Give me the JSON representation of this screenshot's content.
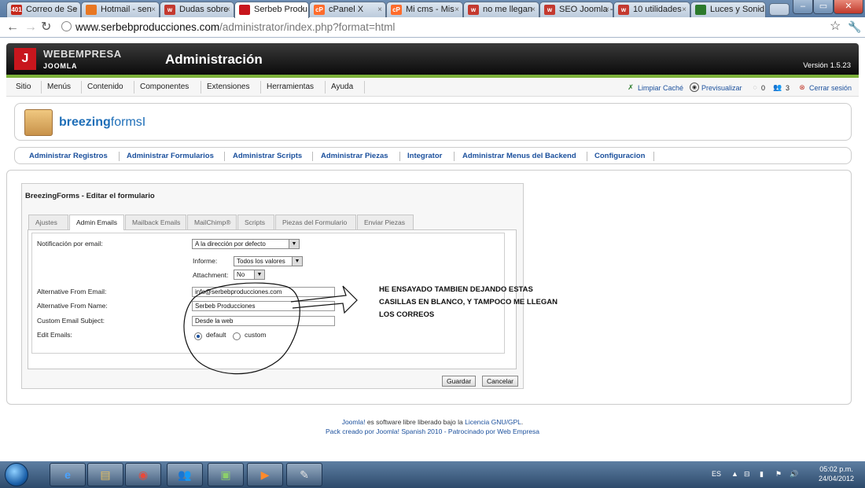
{
  "browser": {
    "tabs": [
      {
        "label": "Correo de Se",
        "favicon": "gmail-icon",
        "color": "#c5281c",
        "badge": "401"
      },
      {
        "label": "Hotmail - sen",
        "favicon": "hotmail-icon",
        "color": "#e87722"
      },
      {
        "label": "Dudas sobre",
        "favicon": "forum-icon",
        "color": "#c4392f",
        "badge": "w"
      },
      {
        "label": "Serbeb Produ",
        "favicon": "joomla-icon",
        "color": "#c8161d",
        "active": true
      },
      {
        "label": "cPanel X",
        "favicon": "cpanel-icon",
        "color": "#ff6c2c",
        "badge": "cP"
      },
      {
        "label": "Mi cms - Mis",
        "favicon": "cpanel-icon",
        "color": "#ff6c2c",
        "badge": "cP"
      },
      {
        "label": "no me llegan",
        "favicon": "forum-icon",
        "color": "#c4392f",
        "badge": "w"
      },
      {
        "label": "SEO Joomla -",
        "favicon": "forum-icon",
        "color": "#c4392f",
        "badge": "w"
      },
      {
        "label": "10 utilidades",
        "favicon": "forum-icon",
        "color": "#c4392f",
        "badge": "w"
      },
      {
        "label": "Luces y Sonid",
        "favicon": "site-icon",
        "color": "#2c7a2c"
      }
    ],
    "url_host": "www.serbebproducciones.com",
    "url_path": "/administrator/index.php?format=html"
  },
  "joomla": {
    "brand_top": "WEBEMPRESA",
    "brand_bottom": "JOOMLA",
    "title": "Administración",
    "version": "Versión 1.5.23",
    "menu": [
      "Sitio",
      "Menús",
      "Contenido",
      "Componentes",
      "Extensiones",
      "Herramientas",
      "Ayuda"
    ],
    "right": {
      "clear_cache": "Limpiar Caché",
      "preview": "Previsualizar",
      "count1": "0",
      "count2": "3",
      "logout": "Cerrar sesión"
    }
  },
  "component": {
    "logo_bold": "breezing",
    "logo_light": "forms",
    "submenu": [
      "Administrar Registros",
      "Administrar Formularios",
      "Administrar Scripts",
      "Administrar Piezas",
      "Integrator",
      "Administrar Menus del Backend",
      "Configuracion"
    ]
  },
  "form": {
    "title": "BreezingForms - Editar el formulario",
    "tabs": [
      "Ajustes",
      "Admin Emails",
      "Mailback Emails",
      "MailChimp®",
      "Scripts",
      "Piezas del Formulario",
      "Enviar Piezas"
    ],
    "active_tab": 1,
    "notif_label": "Notificación por email:",
    "notif_value": "A la dirección por defecto",
    "informe_label": "Informe:",
    "informe_value": "Todos los valores",
    "attachment_label": "Attachment:",
    "attachment_value": "No",
    "alt_from_email_label": "Alternative From Email:",
    "alt_from_email_value": "info@serbebproducciones.com",
    "alt_from_name_label": "Alternative From Name:",
    "alt_from_name_value": "Serbeb Producciones",
    "subject_label": "Custom Email Subject:",
    "subject_value": "Desde la web",
    "edit_emails_label": "Edit Emails:",
    "edit_default": "default",
    "edit_custom": "custom",
    "save": "Guardar",
    "cancel": "Cancelar"
  },
  "annotation": {
    "line1": "HE ENSAYADO TAMBIEN DEJANDO ESTAS",
    "line2": "CASILLAS EN BLANCO, Y TAMPOCO ME LLEGAN",
    "line3": "LOS CORREOS"
  },
  "footer": {
    "l1_a": "Joomla!",
    "l1_b": " es software libre liberado bajo la ",
    "l1_c": "Licencia GNU/GPL",
    "l1_d": ".",
    "l2": "Pack creado por Joomla! Spanish 2010 - Patrocinado por Web Empresa"
  },
  "taskbar": {
    "lang": "ES",
    "time": "05:02 p.m.",
    "date": "24/04/2012"
  }
}
